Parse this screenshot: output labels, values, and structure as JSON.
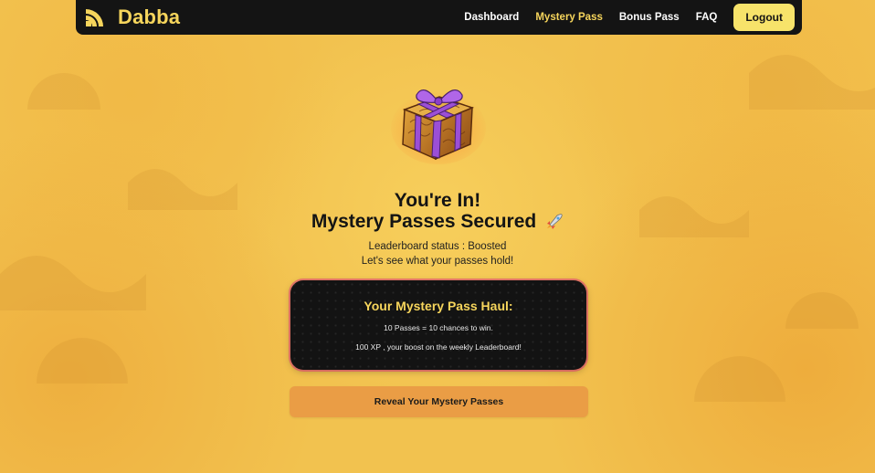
{
  "navbar": {
    "brand": "Dabba",
    "brand_icon": "signal-waves-icon",
    "links": [
      "Dashboard",
      "Mystery Pass",
      "Bonus Pass",
      "FAQ"
    ],
    "active_link": "Mystery Pass",
    "logout_label": "Logout"
  },
  "hero": {
    "gift_icon": "gift-box-icon",
    "title_line1": "You're In!",
    "title_line2": "Mystery Passes Secured",
    "title_emoji": "rocket-icon",
    "status_line": "Leaderboard status : Boosted",
    "subtitle": "Let's see what your passes hold!"
  },
  "haul": {
    "title": "Your Mystery Pass Haul:",
    "line1": "10 Passes = 10 chances to win.",
    "line2": "100 XP , your boost on the weekly Leaderboard!"
  },
  "reveal_button": "Reveal Your Mystery Passes",
  "colors": {
    "background": "#f2c24f",
    "navbar": "#141414",
    "accent_yellow": "#f6d55c",
    "logout_bg": "#f7e36a",
    "card_bg": "#131313",
    "button_orange": "#ea9d45",
    "ribbon_purple": "#9b4fd6"
  }
}
